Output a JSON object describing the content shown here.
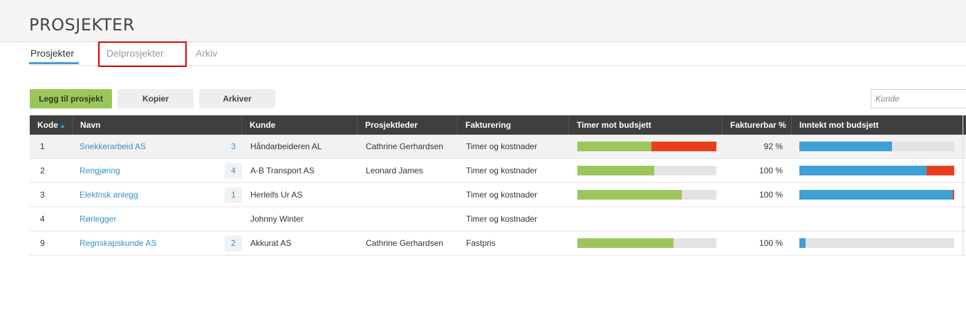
{
  "header": {
    "title": "PROSJEKTER"
  },
  "tabs": [
    {
      "label": "Prosjekter",
      "active": true
    },
    {
      "label": "Delprosjekter",
      "active": false
    },
    {
      "label": "Arkiv",
      "active": false
    }
  ],
  "toolbar": {
    "add_label": "Legg til prosjekt",
    "copy_label": "Kopier",
    "archive_label": "Arkiver",
    "filter_placeholder": "Kunde"
  },
  "colors": {
    "accent": "#3ea0d5",
    "green": "#9cc65b",
    "red": "#e8401c",
    "blue": "#3ea0d5"
  },
  "table": {
    "columns": [
      "Kode",
      "Navn",
      "Kunde",
      "Prosjektleder",
      "Fakturering",
      "Timer mot budsjett",
      "Fakturerbar %",
      "Inntekt mot budsjett"
    ],
    "sort_icon": "sort-ascending-icon",
    "rows": [
      {
        "code": "1",
        "name": "Snekkerarbeid AS",
        "count": "3",
        "customer": "Håndarbeideren AL",
        "leader": "Cathrine Gerhardsen",
        "billing": "Timer og kostnader",
        "hours_green": 0.53,
        "hours_red": 0.47,
        "billable": "92 %",
        "income_blue": 0.6,
        "income_red": 0.0
      },
      {
        "code": "2",
        "name": "Rengjøring",
        "count": "4",
        "customer": "A-B Transport AS",
        "leader": "Leonard James",
        "billing": "Timer og kostnader",
        "hours_green": 0.55,
        "hours_red": 0.0,
        "billable": "100 %",
        "income_blue": 0.82,
        "income_red": 0.18
      },
      {
        "code": "3",
        "name": "Elektrisk anlegg",
        "count": "1",
        "customer": "Herleifs Ur AS",
        "leader": "",
        "billing": "Timer og kostnader",
        "hours_green": 0.75,
        "hours_red": 0.0,
        "billable": "100 %",
        "income_blue": 0.99,
        "income_red": 0.01
      },
      {
        "code": "4",
        "name": "Rørlegger",
        "count": "",
        "customer": "Johnny Winter",
        "leader": "",
        "billing": "Timer og kostnader",
        "hours_green": null,
        "hours_red": null,
        "billable": "",
        "income_blue": null,
        "income_red": null
      },
      {
        "code": "9",
        "name": "Regnskapskunde AS",
        "count": "2",
        "customer": "Akkurat AS",
        "leader": "Cathrine Gerhardsen",
        "billing": "Fastpris",
        "hours_green": 0.69,
        "hours_red": 0.0,
        "billable": "100 %",
        "income_blue": 0.04,
        "income_red": 0.0
      }
    ]
  }
}
